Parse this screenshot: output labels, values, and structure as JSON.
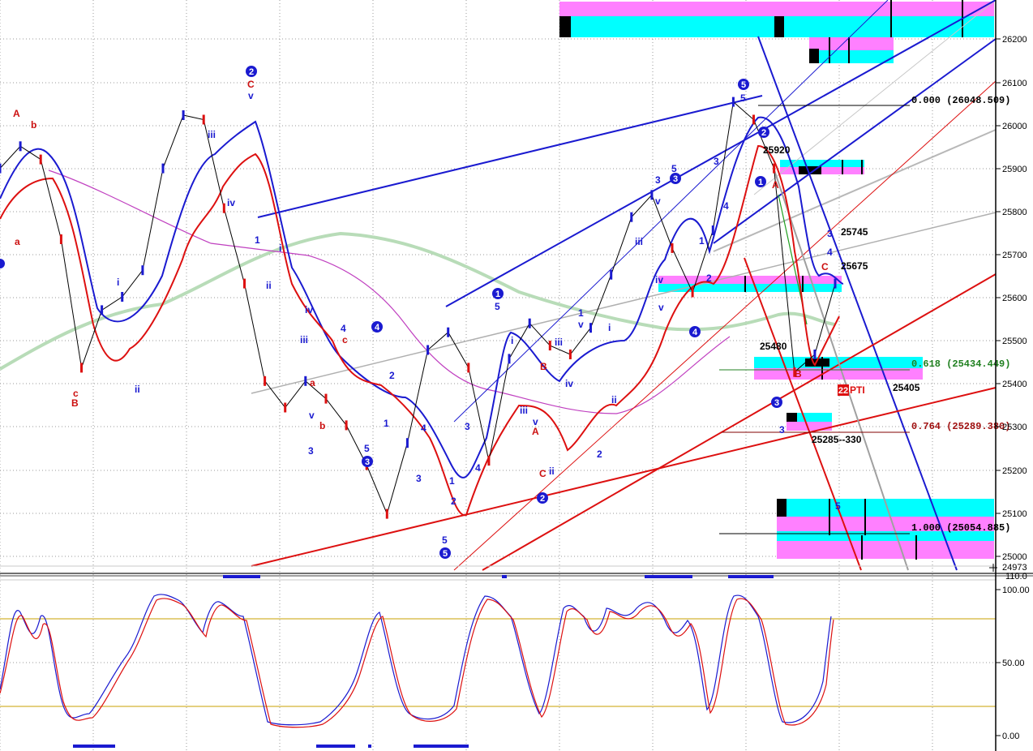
{
  "price_axis": {
    "ticks": [
      "26200",
      "26100",
      "26000",
      "25900",
      "25800",
      "25700",
      "25600",
      "25500",
      "25400",
      "25300",
      "25200",
      "25100",
      "25000"
    ],
    "last_price": "24973",
    "cut_tick": "110.0"
  },
  "osc_axis": {
    "ticks": [
      "100.00",
      "50.00",
      "0.00"
    ]
  },
  "fib_labels": {
    "f0": "0.000 (26048.509)",
    "f618": "0.618 (25434.449)",
    "f764": "0.764 (25289.380)",
    "f1": "1.000 (25054.885)"
  },
  "annotations": {
    "a25745": "25745",
    "a25675": "25675",
    "a25480": "25480",
    "a25405": "25405",
    "a25920": "25920",
    "a25285": "25285--330",
    "pti_num": "22",
    "pti_txt": "PTI"
  },
  "waves": {
    "circ2": "2",
    "circ5a": "5",
    "circ4a": "4",
    "circ3a": "3",
    "circ1b": "1",
    "circ2b": "2",
    "circ3b": "3",
    "circ4b": "4",
    "circ5b": "5",
    "circ1c": "1",
    "circ2c": "2",
    "circ3c": "3",
    "A": "A",
    "B": "B",
    "C": "C",
    "a": "a",
    "b": "b",
    "c": "c",
    "i": "i",
    "ii": "ii",
    "iii": "iii",
    "iv": "iv",
    "v": "v",
    "n1": "1",
    "n2": "2",
    "n3": "3",
    "n4": "4",
    "n5": "5"
  },
  "chart_data": {
    "type": "line",
    "title": "",
    "panels": [
      {
        "name": "price",
        "ylim": [
          24973,
          26260
        ],
        "y_ticks": [
          25000,
          25100,
          25200,
          25300,
          25400,
          25500,
          25600,
          25700,
          25800,
          25900,
          26000,
          26100,
          26200
        ]
      },
      {
        "name": "stochastic",
        "ylim": [
          0,
          100
        ],
        "y_ticks": [
          0,
          50,
          100
        ]
      }
    ],
    "series": [
      {
        "values": [
          25880,
          25930,
          25900,
          25720,
          25430,
          25560,
          25590,
          25650,
          25880,
          26000,
          25990,
          25790,
          25620,
          25400,
          25340,
          25400,
          25360,
          25300,
          25210,
          25100,
          25260,
          25470,
          25510,
          25430,
          25220,
          25450,
          25530,
          25480,
          25460,
          25520,
          25640,
          25770,
          25820,
          25700,
          25600,
          25740,
          26030,
          25990,
          25880,
          25420,
          25460,
          25620
        ]
      }
    ],
    "fib_levels": [
      {
        "ratio": 0.0,
        "price": 26048.509
      },
      {
        "ratio": 0.618,
        "price": 25434.449
      },
      {
        "ratio": 0.764,
        "price": 25289.38
      },
      {
        "ratio": 1.0,
        "price": 25054.885
      }
    ],
    "grid": true
  },
  "colors": {
    "cyan": "#00ffff",
    "magenta": "#ff80ff",
    "blue": "#1a1ad0",
    "red": "#dd1010",
    "green_ma": "#b8dcb8",
    "purple_ma": "#c040c0",
    "osc_blue": "#1a1ad0",
    "osc_red": "#dd1010",
    "gold": "#c8a000"
  }
}
